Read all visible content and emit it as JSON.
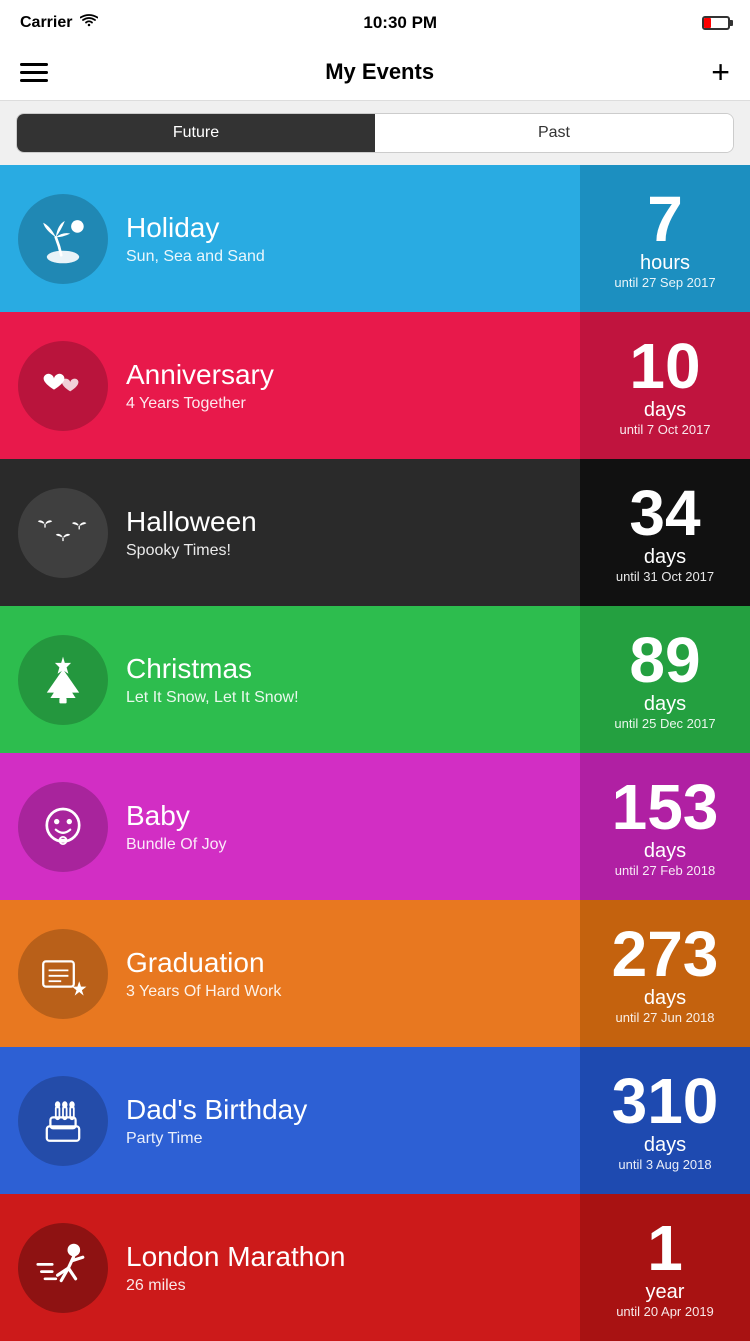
{
  "statusBar": {
    "carrier": "Carrier",
    "time": "10:30 PM"
  },
  "navBar": {
    "title": "My Events",
    "addLabel": "+"
  },
  "segment": {
    "future": "Future",
    "past": "Past"
  },
  "events": [
    {
      "id": "holiday",
      "title": "Holiday",
      "subtitle": "Sun, Sea and Sand",
      "count": "7",
      "unit": "hours",
      "until": "until 27 Sep 2017",
      "colorClass": "card-holiday",
      "iconCircleClass": "icon-circle-holiday",
      "icon": "holiday"
    },
    {
      "id": "anniversary",
      "title": "Anniversary",
      "subtitle": "4 Years Together",
      "count": "10",
      "unit": "days",
      "until": "until 7 Oct 2017",
      "colorClass": "card-anniversary",
      "iconCircleClass": "icon-circle-anniversary",
      "icon": "anniversary"
    },
    {
      "id": "halloween",
      "title": "Halloween",
      "subtitle": "Spooky Times!",
      "count": "34",
      "unit": "days",
      "until": "until 31 Oct 2017",
      "colorClass": "card-halloween",
      "iconCircleClass": "icon-circle-halloween",
      "icon": "halloween"
    },
    {
      "id": "christmas",
      "title": "Christmas",
      "subtitle": "Let It Snow, Let It Snow!",
      "count": "89",
      "unit": "days",
      "until": "until 25 Dec 2017",
      "colorClass": "card-christmas",
      "iconCircleClass": "icon-circle-christmas",
      "icon": "christmas"
    },
    {
      "id": "baby",
      "title": "Baby",
      "subtitle": "Bundle Of Joy",
      "count": "153",
      "unit": "days",
      "until": "until 27 Feb 2018",
      "colorClass": "card-baby",
      "iconCircleClass": "icon-circle-baby",
      "icon": "baby"
    },
    {
      "id": "graduation",
      "title": "Graduation",
      "subtitle": "3 Years Of Hard Work",
      "count": "273",
      "unit": "days",
      "until": "until 27 Jun 2018",
      "colorClass": "card-graduation",
      "iconCircleClass": "icon-circle-graduation",
      "icon": "graduation"
    },
    {
      "id": "birthday",
      "title": "Dad's Birthday",
      "subtitle": "Party Time",
      "count": "310",
      "unit": "days",
      "until": "until 3 Aug 2018",
      "colorClass": "card-birthday",
      "iconCircleClass": "icon-circle-birthday",
      "icon": "birthday"
    },
    {
      "id": "marathon",
      "title": "London Marathon",
      "subtitle": "26 miles",
      "count": "1",
      "unit": "year",
      "until": "until 20 Apr 2019",
      "colorClass": "card-marathon",
      "iconCircleClass": "icon-circle-marathon",
      "icon": "marathon"
    }
  ]
}
